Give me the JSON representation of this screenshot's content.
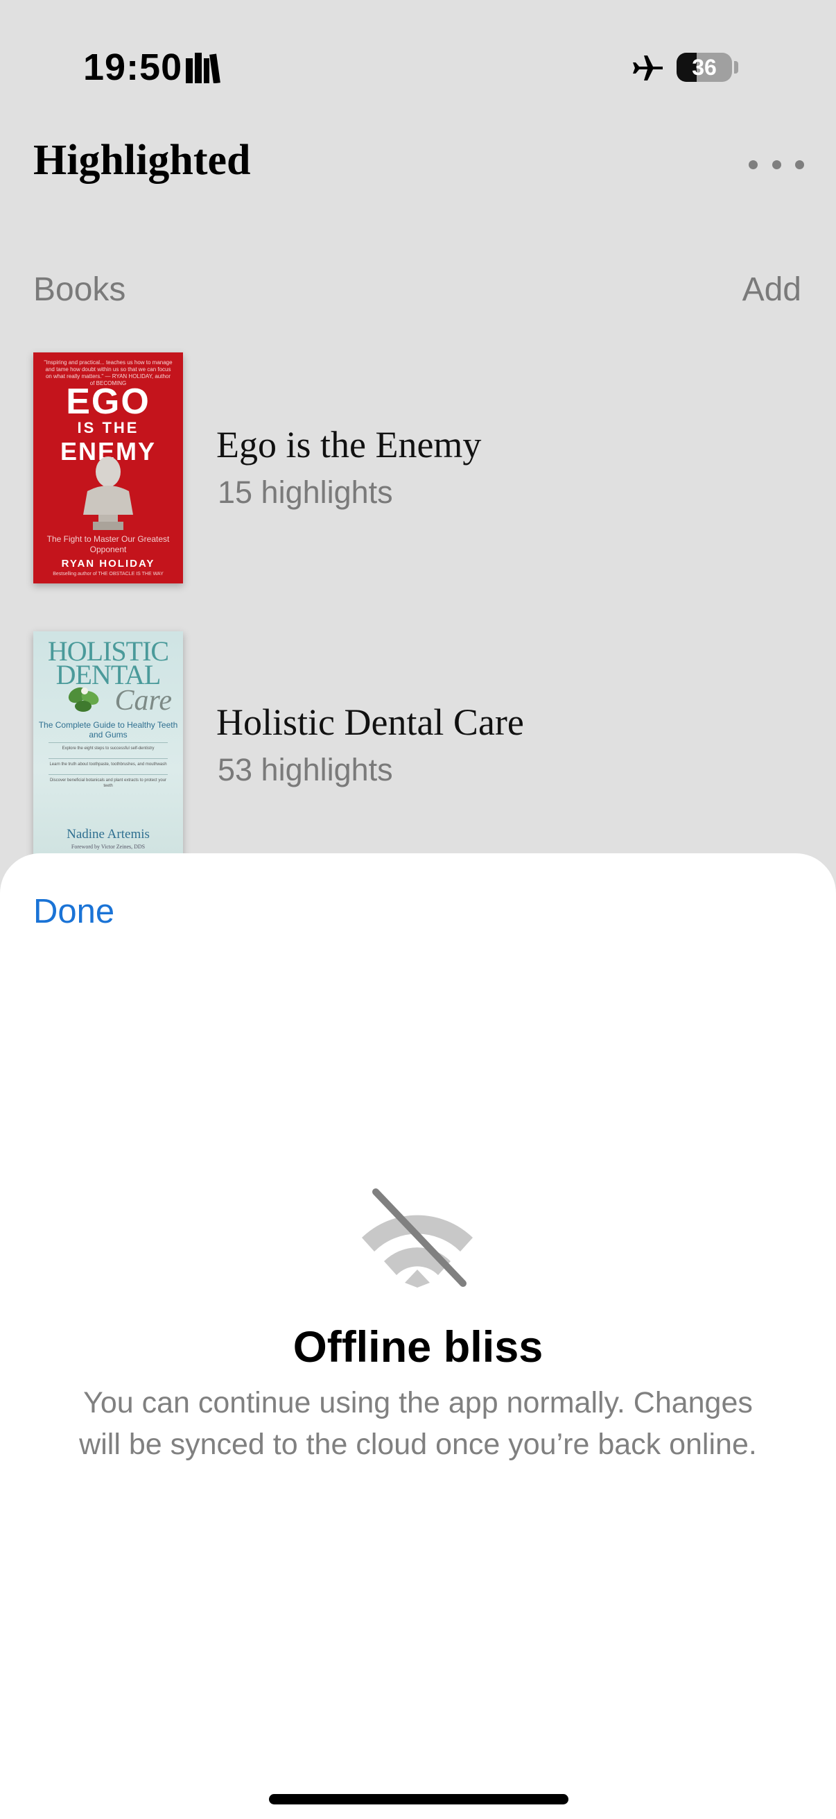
{
  "status_bar": {
    "time": "19:50",
    "battery_level": "36",
    "battery_fraction": 0.36,
    "icons": [
      "books-icon",
      "airplane-icon",
      "battery-icon"
    ]
  },
  "header": {
    "title": "Highlighted",
    "more_icon": "ellipsis-icon"
  },
  "books_section": {
    "label": "Books",
    "add_label": "Add",
    "items": [
      {
        "title": "Ego is the Enemy",
        "highlights": "15 highlights",
        "cover": {
          "blurb": "\"Inspiring and practical... teaches us how to manage and tame how doubt within us so that we can focus on what really matters.\" — RYAN HOLIDAY, author of BECOMING",
          "line1": "EGO",
          "line2": "IS THE",
          "line3": "ENEMY",
          "subtitle": "The Fight to Master Our Greatest Opponent",
          "author": "RYAN HOLIDAY",
          "tagline": "Bestselling author of THE OBSTACLE IS THE WAY",
          "color": "#c4141c"
        }
      },
      {
        "title": "Holistic Dental Care",
        "highlights": "53 highlights",
        "cover": {
          "line1": "HOLISTIC",
          "line2": "DENTAL",
          "line3": "Care",
          "subtitle": "The Complete Guide to Healthy Teeth and Gums",
          "bullets": [
            "Explore the eight steps to successful self-dentistry",
            "Learn the truth about toothpaste, toothbrushes, and mouthwash",
            "Discover beneficial botanicals and plant extracts to protect your teeth"
          ],
          "author": "Nadine Artemis",
          "foreword": "Foreword by Victor Zeines, DDS",
          "color": "#4a9a9a"
        }
      }
    ]
  },
  "sheet": {
    "done_label": "Done",
    "icon": "wifi-off-icon",
    "title": "Offline bliss",
    "description": "You can continue using the app normally. Changes will be synced to the cloud once you’re back online."
  },
  "colors": {
    "accent": "#1a73d6",
    "background": "#e0e0e0",
    "sheet": "#ffffff",
    "secondary_text": "#808080"
  }
}
